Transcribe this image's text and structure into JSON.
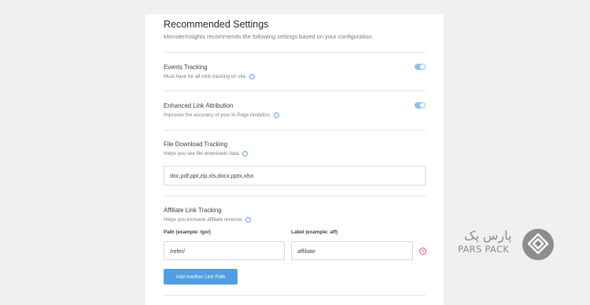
{
  "settings": {
    "title": "Recommended Settings",
    "subtitle": "MonsterInsights recommends the following settings based on your configuration.",
    "events_tracking": {
      "label": "Events Tracking",
      "description": "Must have for all click tracking on site.",
      "enabled": true
    },
    "enhanced_link": {
      "label": "Enhanced Link Attribution",
      "description": "Improves the accuracy of your In-Page Analytics.",
      "enabled": true
    },
    "file_download": {
      "label": "File Download Tracking",
      "description": "Helps you see file downloads data.",
      "value": "doc,pdf,ppt,zip,xls,docx,pptx,xlsx"
    },
    "affiliate": {
      "label": "Affiliate Link Tracking",
      "description": "Helps you increase affiliate revenue.",
      "path_label": "Path (example: /go/)",
      "label_label": "Label (example: aff)",
      "path_value": "/refer/",
      "label_value": "affiliate",
      "add_button": "Add Another Link Path"
    }
  },
  "watermark": {
    "persian": "پارس پک",
    "english": "PARS PACK"
  },
  "colors": {
    "accent": "#509fe2",
    "toggle_on": "#8fc3ec",
    "remove": "#d9534f"
  }
}
